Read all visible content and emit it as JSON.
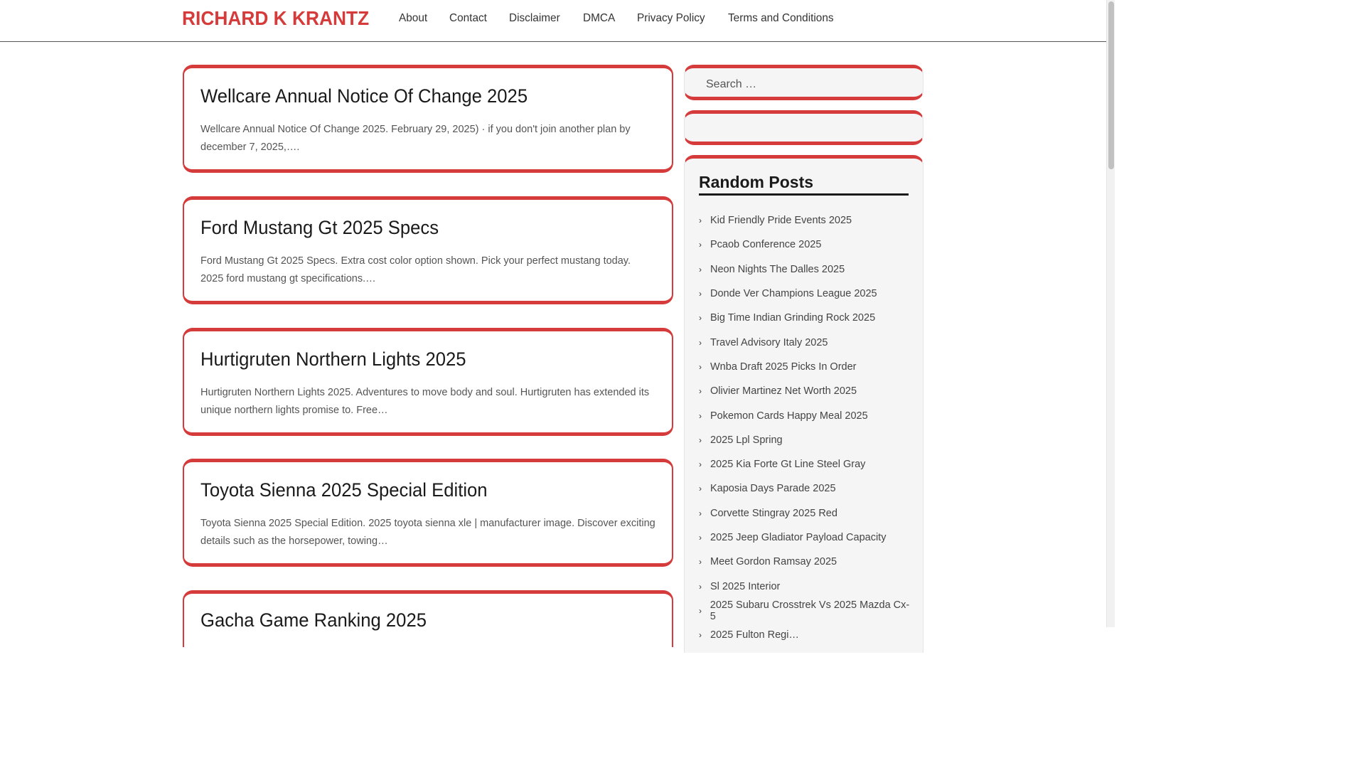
{
  "site": {
    "title": "RICHARD K KRANTZ"
  },
  "nav": [
    "About",
    "Contact",
    "Disclaimer",
    "DMCA",
    "Privacy Policy",
    "Terms and Conditions"
  ],
  "posts": [
    {
      "title": "Wellcare Annual Notice Of Change 2025",
      "excerpt": "Wellcare Annual Notice Of Change 2025. February 29, 2025) · if you don't join another plan by december 7, 2025,…."
    },
    {
      "title": "Ford Mustang Gt 2025 Specs",
      "excerpt": "Ford Mustang Gt 2025 Specs. Extra cost color option shown. Pick your perfect mustang today. 2025 ford mustang gt specifications.…"
    },
    {
      "title": "Hurtigruten Northern Lights 2025",
      "excerpt": "Hurtigruten Northern Lights 2025. Adventures to move body and soul. Hurtigruten has extended its unique northern lights promise to. Free…"
    },
    {
      "title": "Toyota Sienna 2025 Special Edition",
      "excerpt": "Toyota Sienna 2025 Special Edition. 2025 toyota sienna xle | manufacturer image. Discover exciting details such as the horsepower, towing…"
    },
    {
      "title": "Gacha Game Ranking 2025",
      "excerpt": ""
    }
  ],
  "search": {
    "placeholder": "Search …"
  },
  "random_posts": {
    "title": "Random Posts",
    "items": [
      "Kid Friendly Pride Events 2025",
      "Pcaob Conference 2025",
      "Neon Nights The Dalles 2025",
      "Donde Ver Champions League 2025",
      "Big Time Indian Grinding Rock 2025",
      "Travel Advisory Italy 2025",
      "Wnba Draft 2025 Picks In Order",
      "Olivier Martinez Net Worth 2025",
      "Pokemon Cards Happy Meal 2025",
      "2025 Lpl Spring",
      "2025 Kia Forte Gt Line Steel Gray",
      "Kaposia Days Parade 2025",
      "Corvette Stingray 2025 Red",
      "2025 Jeep Gladiator Payload Capacity",
      "Meet Gordon Ramsay 2025",
      "Sl 2025 Interior",
      "2025 Subaru Crosstrek Vs 2025 Mazda Cx-5",
      "2025 Fulton Regi…"
    ]
  },
  "colors": {
    "accent": "#d63b3b"
  }
}
